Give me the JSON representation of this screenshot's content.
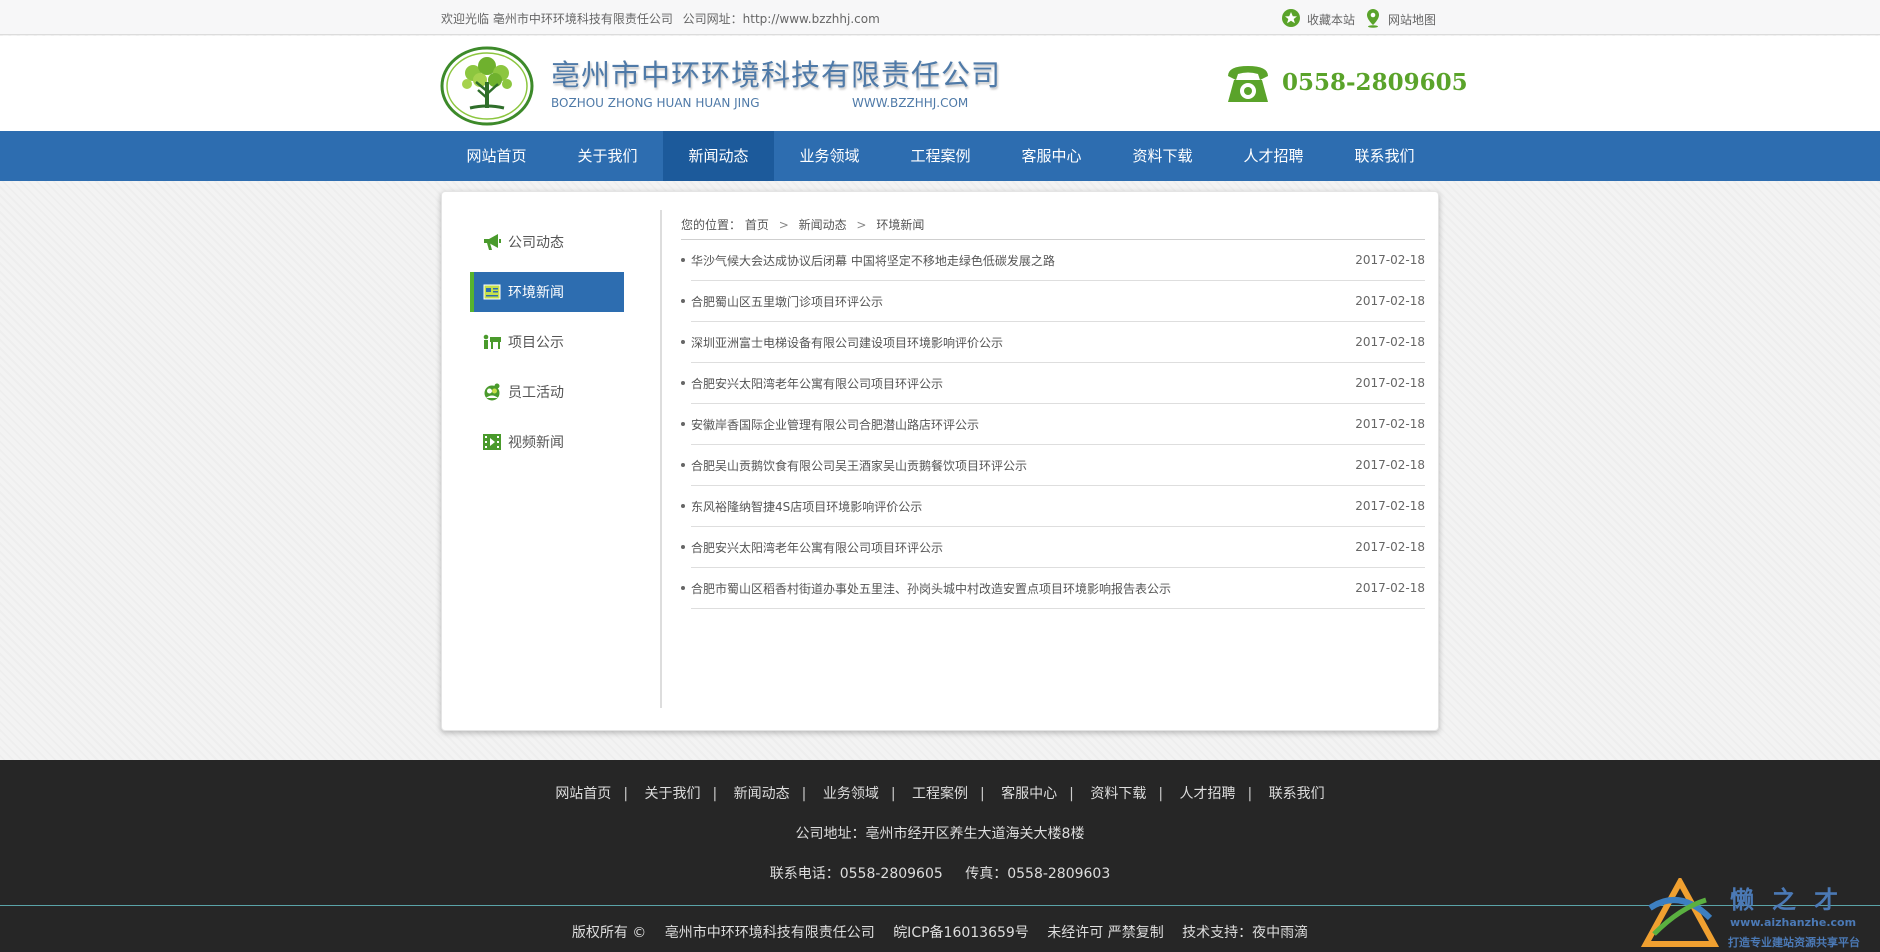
{
  "topbar": {
    "welcome": "欢迎光临 亳州市中环环境科技有限责任公司",
    "url": "公司网址：http://www.bzzhhj.com",
    "favorite": "收藏本站",
    "sitemap": "网站地图"
  },
  "header": {
    "company_name": "亳州市中环环境科技有限责任公司",
    "company_en": "BOZHOU ZHONG HUAN HUAN JING",
    "company_site": "WWW.BZZHHJ.COM",
    "phone": "0558-2809605"
  },
  "nav": {
    "items": [
      {
        "label": "网站首页"
      },
      {
        "label": "关于我们"
      },
      {
        "label": "新闻动态"
      },
      {
        "label": "业务领域"
      },
      {
        "label": "工程案例"
      },
      {
        "label": "客服中心"
      },
      {
        "label": "资料下载"
      },
      {
        "label": "人才招聘"
      },
      {
        "label": "联系我们"
      }
    ],
    "active_index": 2
  },
  "sidebar": {
    "items": [
      {
        "label": "公司动态",
        "icon": "megaphone-icon"
      },
      {
        "label": "环境新闻",
        "icon": "newspaper-icon"
      },
      {
        "label": "项目公示",
        "icon": "projects-icon"
      },
      {
        "label": "员工活动",
        "icon": "people-icon"
      },
      {
        "label": "视频新闻",
        "icon": "film-icon"
      }
    ],
    "active_index": 1
  },
  "breadcrumb": {
    "prefix": "您的位置：",
    "items": [
      "首页",
      "新闻动态",
      "环境新闻"
    ],
    "separator": ">"
  },
  "news": [
    {
      "title": "华沙气候大会达成协议后闭幕 中国将坚定不移地走绿色低碳发展之路",
      "date": "2017-02-18"
    },
    {
      "title": "合肥蜀山区五里墩门诊项目环评公示",
      "date": "2017-02-18"
    },
    {
      "title": "深圳亚洲富士电梯设备有限公司建设项目环境影响评价公示",
      "date": "2017-02-18"
    },
    {
      "title": "合肥安兴太阳湾老年公寓有限公司项目环评公示",
      "date": "2017-02-18"
    },
    {
      "title": "安徽岸香国际企业管理有限公司合肥潜山路店环评公示",
      "date": "2017-02-18"
    },
    {
      "title": "合肥吴山贡鹅饮食有限公司吴王酒家吴山贡鹅餐饮项目环评公示",
      "date": "2017-02-18"
    },
    {
      "title": "东风裕隆纳智捷4S店项目环境影响评价公示",
      "date": "2017-02-18"
    },
    {
      "title": "合肥安兴太阳湾老年公寓有限公司项目环评公示",
      "date": "2017-02-18"
    },
    {
      "title": "合肥市蜀山区稻香村街道办事处五里洼、孙岗头城中村改造安置点项目环境影响报告表公示",
      "date": "2017-02-18"
    }
  ],
  "footer": {
    "links": [
      "网站首页",
      "关于我们",
      "新闻动态",
      "业务领域",
      "工程案例",
      "客服中心",
      "资料下载",
      "人才招聘",
      "联系我们"
    ],
    "address": "公司地址：亳州市经开区养生大道海关大楼8楼",
    "tel": "联系电话：0558-2809605",
    "fax": "传真：0558-2809603",
    "copyright": "版权所有 ©",
    "company": "亳州市中环环境科技有限责任公司",
    "icp": "皖ICP备16013659号",
    "notice": "未经许可 严禁复制",
    "support": "技术支持：夜中雨滴"
  },
  "watermark": {
    "brand": "懒之才",
    "url": "www.aizhanzhe.com",
    "slogan": "打造专业建站资源共享平台"
  },
  "colors": {
    "nav_blue": "#2d6db0",
    "nav_active": "#1c5a9b",
    "green": "#5aa32a",
    "footer_bg": "#262626"
  }
}
